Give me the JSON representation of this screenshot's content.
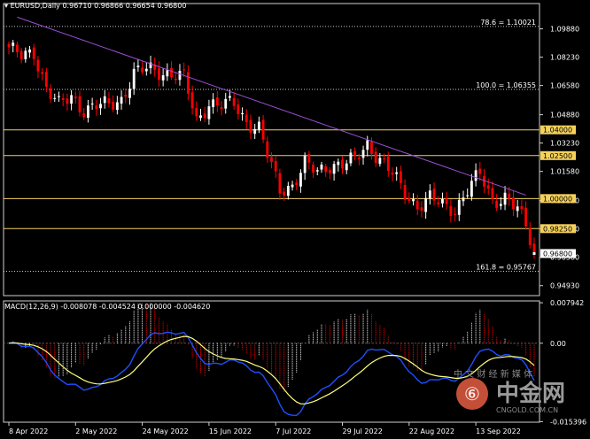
{
  "header": {
    "symbol": "EURUSD,Daily",
    "ohlc": "0.96710 0.96866 0.96654 0.96800"
  },
  "macd_header": "MACD(12,26,9) -0.008078 -0.004524 0.000000 -0.004620",
  "watermark": {
    "brand": "中金网",
    "tagline": "中 文 财 经 新 媒 体",
    "url": "CNGOLD.COM.CN"
  },
  "colors": {
    "background": "#000000",
    "bull": "#ffffff",
    "bear": "#ff0000",
    "level_line": "#f0d060",
    "fib_line": "#c8c8c8",
    "trend_line": "#9c4fd6",
    "macd_signal": "#ffff80",
    "macd_line": "#1e4fff",
    "price_tag_bg": "#f5d15a"
  },
  "chart_data": [
    {
      "type": "candlestick",
      "title": "EURUSD,Daily",
      "ylim": [
        0.9435,
        1.1063
      ],
      "price_ticks": [
        "1.09880",
        "1.08230",
        "1.06580",
        "1.04880",
        "1.03230",
        "1.01580",
        "0.99880",
        "0.98230",
        "0.96580",
        "0.94930"
      ],
      "x_ticks": [
        {
          "label": "8 Apr 2022",
          "i": 0
        },
        {
          "label": "2 May 2022",
          "i": 16
        },
        {
          "label": "24 May 2022",
          "i": 32
        },
        {
          "label": "15 Jun 2022",
          "i": 48
        },
        {
          "label": "7 Jul 2022",
          "i": 64
        },
        {
          "label": "29 Jul 2022",
          "i": 80
        },
        {
          "label": "22 Aug 2022",
          "i": 96
        },
        {
          "label": "13 Sep 2022",
          "i": 112
        }
      ],
      "current_price": "0.96800",
      "levels": [
        {
          "price": 1.04,
          "label": "1.04000",
          "kind": "tag"
        },
        {
          "price": 1.025,
          "label": "1.02500",
          "kind": "tag"
        },
        {
          "price": 1.0,
          "label": "1.00000",
          "kind": "tag"
        },
        {
          "price": 0.9825,
          "label": "0.98250",
          "kind": "tag"
        }
      ],
      "fib_levels": [
        {
          "price": 1.10021,
          "label": "78.6 = 1.10021"
        },
        {
          "price": 1.06355,
          "label": "100.0 = 1.06355"
        },
        {
          "price": 0.95767,
          "label": "161.8 = 0.95767"
        }
      ],
      "trendline": {
        "from": {
          "i": 2,
          "price": 1.1056
        },
        "to": {
          "i": 124,
          "price": 1.002
        }
      },
      "anchors": [
        [
          0,
          1.088
        ],
        [
          3,
          1.082
        ],
        [
          6,
          1.085
        ],
        [
          9,
          1.065
        ],
        [
          12,
          1.054
        ],
        [
          15,
          1.059
        ],
        [
          18,
          1.052
        ],
        [
          21,
          1.054
        ],
        [
          24,
          1.054
        ],
        [
          27,
          1.058
        ],
        [
          30,
          1.073
        ],
        [
          33,
          1.075
        ],
        [
          36,
          1.074
        ],
        [
          39,
          1.073
        ],
        [
          42,
          1.07
        ],
        [
          45,
          1.045
        ],
        [
          48,
          1.056
        ],
        [
          51,
          1.054
        ],
        [
          54,
          1.055
        ],
        [
          57,
          1.045
        ],
        [
          60,
          1.041
        ],
        [
          62,
          1.025
        ],
        [
          65,
          1.005
        ],
        [
          68,
          1.008
        ],
        [
          71,
          1.02
        ],
        [
          74,
          1.015
        ],
        [
          77,
          1.02
        ],
        [
          80,
          1.02
        ],
        [
          83,
          1.022
        ],
        [
          86,
          1.032
        ],
        [
          89,
          1.023
        ],
        [
          92,
          1.014
        ],
        [
          95,
          1.003
        ],
        [
          98,
          0.996
        ],
        [
          101,
          1.0
        ],
        [
          104,
          0.996
        ],
        [
          107,
          0.994
        ],
        [
          110,
          1.005
        ],
        [
          113,
          1.014
        ],
        [
          116,
          0.999
        ],
        [
          119,
          1.001
        ],
        [
          122,
          0.993
        ],
        [
          124,
          0.984
        ],
        [
          126,
          0.969
        ]
      ]
    },
    {
      "type": "bar",
      "title": "MACD(12,26,9)",
      "ylim": [
        -0.0155,
        0.0083
      ],
      "y_ticks": [
        {
          "label": "0.007942",
          "value": 0.007942
        },
        {
          "label": "0.00",
          "value": 0.0
        },
        {
          "label": "-0.015396",
          "value": -0.015396
        }
      ]
    }
  ]
}
